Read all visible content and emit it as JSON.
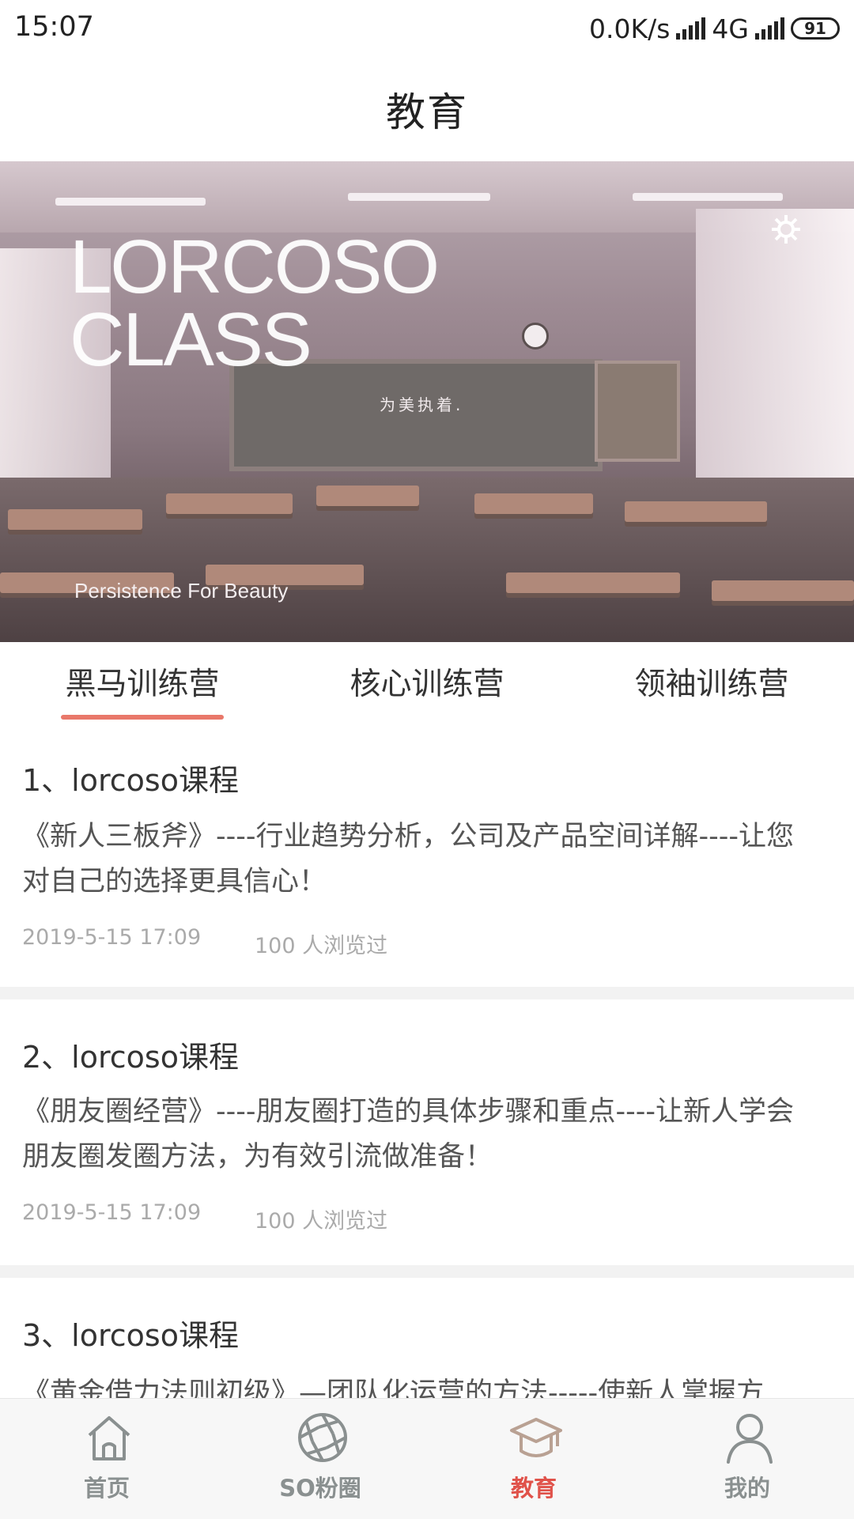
{
  "status_bar": {
    "time": "15:07",
    "net_speed": "0.0K/s",
    "network": "4G",
    "battery": "91"
  },
  "header": {
    "title": "教育"
  },
  "banner": {
    "brand_line1": "LORCOSO",
    "brand_line2": "CLASS",
    "tagline": "为美执着.",
    "slogan": "Persistence For Beauty",
    "icon": "gear-icon"
  },
  "tabs": [
    {
      "label": "黑马训练营",
      "active": true
    },
    {
      "label": "核心训练营",
      "active": false
    },
    {
      "label": "领袖训练营",
      "active": false
    }
  ],
  "accent_color": "#e9786a",
  "courses": [
    {
      "title": "1、lorcoso课程",
      "desc_line1": "《新人三板斧》----行业趋势分析，公司及产品空间详解----让您",
      "desc_line2": "对自己的选择更具信心！",
      "date": "2019-5-15 17:09",
      "views": "100 人浏览过"
    },
    {
      "title": "2、lorcoso课程",
      "desc_line1": "《朋友圈经营》----朋友圈打造的具体步骤和重点----让新人学会",
      "desc_line2": "朋友圈发圈方法，为有效引流做准备！",
      "date": "2019-5-15 17:09",
      "views": "100 人浏览过"
    },
    {
      "title": "3、lorcoso课程",
      "desc_line1": "《黄金借力法则初级》—团队化运营的方法-----使新人掌握方"
    }
  ],
  "bottom_nav": [
    {
      "label": "首页",
      "icon": "home-icon",
      "active": false
    },
    {
      "label": "SO粉圈",
      "icon": "aperture-icon",
      "active": false
    },
    {
      "label": "教育",
      "icon": "graduation-cap-icon",
      "active": true
    },
    {
      "label": "我的",
      "icon": "user-icon",
      "active": false
    }
  ],
  "active_color": "#e0524a"
}
